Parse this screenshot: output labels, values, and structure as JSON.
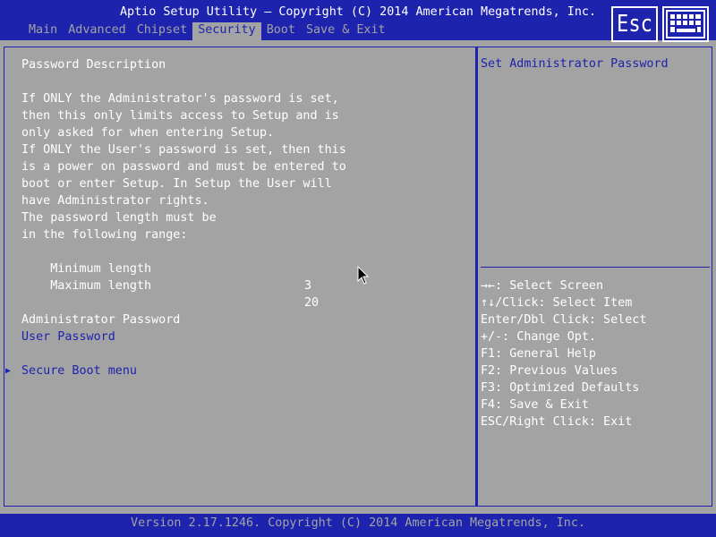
{
  "header": {
    "title": "Aptio Setup Utility – Copyright (C) 2014 American Megatrends, Inc.",
    "tabs": [
      "Main",
      "Advanced",
      "Chipset",
      "Security",
      "Boot",
      "Save & Exit"
    ],
    "active_tab": "Security",
    "esc_label": "Esc",
    "keyboard_icon": "keyboard-icon"
  },
  "main": {
    "description_lines": [
      "Password Description",
      "",
      "If ONLY the Administrator's password is set,",
      "then this only limits access to Setup and is",
      "only asked for when entering Setup.",
      "If ONLY the User's password is set, then this",
      "is a power on password and must be entered to",
      "boot or enter Setup. In Setup the User will",
      "have Administrator rights.",
      "The password length must be",
      "in the following range:"
    ],
    "min_label": "Minimum length",
    "min_value": "3",
    "max_label": "Maximum length",
    "max_value": "20",
    "admin_password": "Administrator Password",
    "user_password": "User Password",
    "secure_boot_menu": "Secure Boot menu",
    "submenu_arrow": "▶"
  },
  "help": {
    "title": "Set Administrator Password",
    "keys": [
      "→←: Select Screen",
      "↑↓/Click: Select Item",
      "Enter/Dbl Click: Select",
      "+/-: Change Opt.",
      "F1: General Help",
      "F2: Previous Values",
      "F3: Optimized Defaults",
      "F4: Save & Exit",
      "ESC/Right Click: Exit"
    ]
  },
  "footer": {
    "text": "Version 2.17.1246. Copyright (C) 2014 American Megatrends, Inc."
  },
  "colors": {
    "bios_blue": "#1d23ad",
    "panel_gray": "#a3a3a3",
    "text_white": "#ffffff"
  }
}
